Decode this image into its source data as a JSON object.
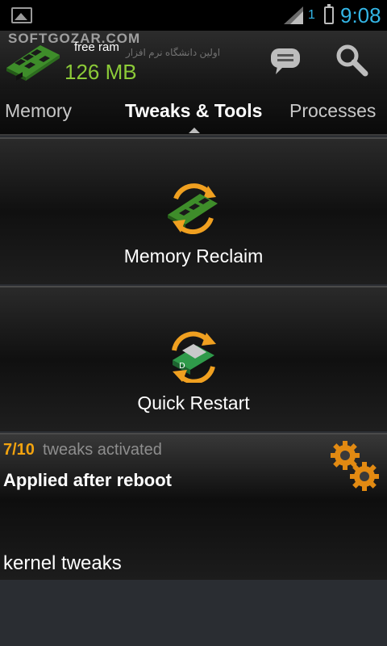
{
  "status_bar": {
    "network_type": "1",
    "time": "9:08"
  },
  "header": {
    "watermark": "SOFTGOZAR.COM",
    "watermark_sub": "اولین دانشگاه نرم افزار",
    "free_ram_label": "free ram",
    "free_ram_value": "126 MB",
    "icons": [
      "ram-chip-icon",
      "chat-icon",
      "search-icon"
    ]
  },
  "tabs": [
    {
      "label": "Memory",
      "active": false
    },
    {
      "label": "Tweaks & Tools",
      "active": true
    },
    {
      "label": "Processes",
      "active": false
    }
  ],
  "actions": [
    {
      "label": "Memory Reclaim",
      "icon": "memory-reclaim-icon"
    },
    {
      "label": "Quick Restart",
      "icon": "quick-restart-icon"
    }
  ],
  "tweaks": {
    "count": "7/10",
    "count_text": "tweaks activated",
    "applied": "Applied after reboot",
    "section": "kernel tweaks",
    "icon": "gears-icon"
  },
  "colors": {
    "accent_blue": "#33b5e5",
    "ram_green": "#8ccb38",
    "tweak_orange": "#f2a30f"
  }
}
